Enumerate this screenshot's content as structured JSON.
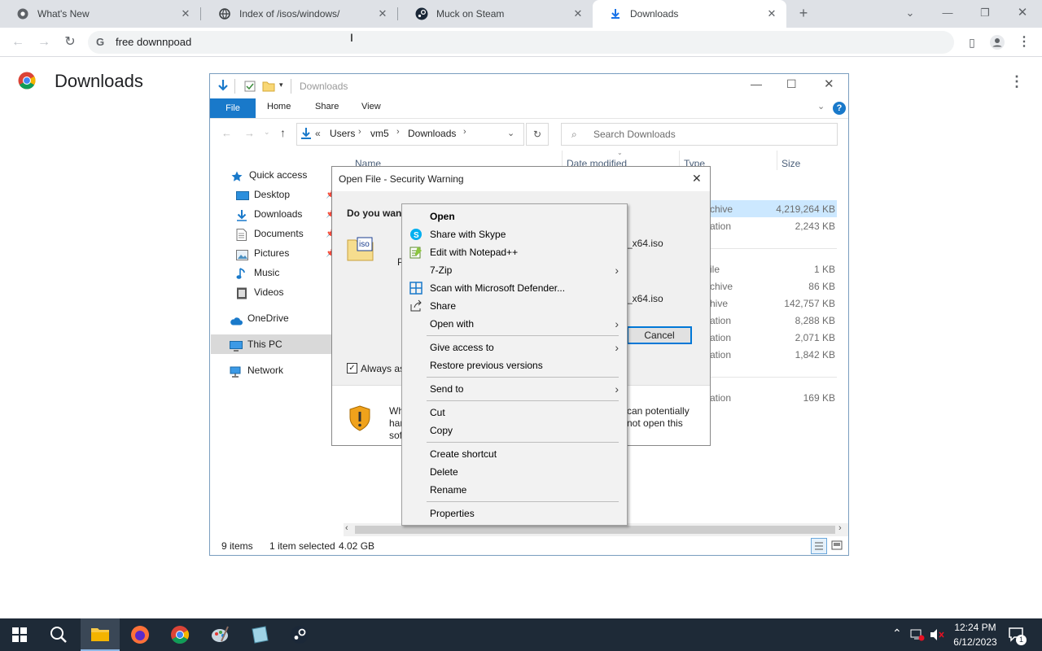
{
  "browser": {
    "tabs": [
      {
        "title": "What's New",
        "icon": "chrome-icon"
      },
      {
        "title": "Index of /isos/windows/",
        "icon": "globe-icon"
      },
      {
        "title": "Muck on Steam",
        "icon": "steam-icon"
      },
      {
        "title": "Downloads",
        "icon": "download-icon",
        "active": true
      }
    ],
    "new_tab": "+",
    "address": "free downnpoad",
    "page_title": "Downloads"
  },
  "explorer": {
    "title": "Downloads",
    "ribbon_tabs": [
      "File",
      "Home",
      "Share",
      "View"
    ],
    "breadcrumb": [
      "«",
      "Users",
      "vm5",
      "Downloads"
    ],
    "search_placeholder": "Search Downloads",
    "columns": {
      "name": "Name",
      "date": "Date modified",
      "type": "Type",
      "size": "Size"
    },
    "nav": {
      "quick_access": "Quick access",
      "items": [
        "Desktop",
        "Downloads",
        "Documents",
        "Pictures",
        "Music",
        "Videos"
      ],
      "onedrive": "OneDrive",
      "this_pc": "This PC",
      "network": "Network"
    },
    "rows": [
      {
        "type": "chive",
        "size": "4,219,264 KB"
      },
      {
        "type": "ation",
        "size": "2,243 KB"
      },
      {
        "type": "ile",
        "size": "1 KB"
      },
      {
        "type": "chive",
        "size": "86 KB"
      },
      {
        "type": "hive",
        "size": "142,757 KB"
      },
      {
        "type": "ation",
        "size": "8,288 KB"
      },
      {
        "type": "ation",
        "size": "2,071 KB"
      },
      {
        "type": "ation",
        "size": "1,842 KB"
      },
      {
        "type": "ation",
        "size": "169 KB"
      }
    ],
    "file_fragment_1": "_x64.iso",
    "file_fragment_2": "_x64.iso",
    "status_items": "9 items",
    "status_selected": "1 item selected",
    "status_size": "4.02 GB"
  },
  "security_dialog": {
    "title": "Open File - Security Warning",
    "question": "Do you want",
    "label_p": "P",
    "always_ask": "Always as",
    "cancel": "Cancel",
    "warn_left_1": "Wh",
    "warn_left_2": "har",
    "warn_left_3": "sof",
    "warn_right_1": "can potentially",
    "warn_right_2": "not open this"
  },
  "context_menu": {
    "open": "Open",
    "skype": "Share with Skype",
    "notepad": "Edit with Notepad++",
    "zip": "7-Zip",
    "defender": "Scan with Microsoft Defender...",
    "share": "Share",
    "open_with": "Open with",
    "give_access": "Give access to",
    "restore": "Restore previous versions",
    "send_to": "Send to",
    "cut": "Cut",
    "copy": "Copy",
    "create_shortcut": "Create shortcut",
    "delete": "Delete",
    "rename": "Rename",
    "properties": "Properties"
  },
  "taskbar": {
    "time": "12:24 PM",
    "date": "6/12/2023",
    "notification_count": "1"
  },
  "colors": {
    "tabstrip": "#dee1e6",
    "accent_blue": "#1979ca",
    "taskbar": "#1e2a37"
  }
}
